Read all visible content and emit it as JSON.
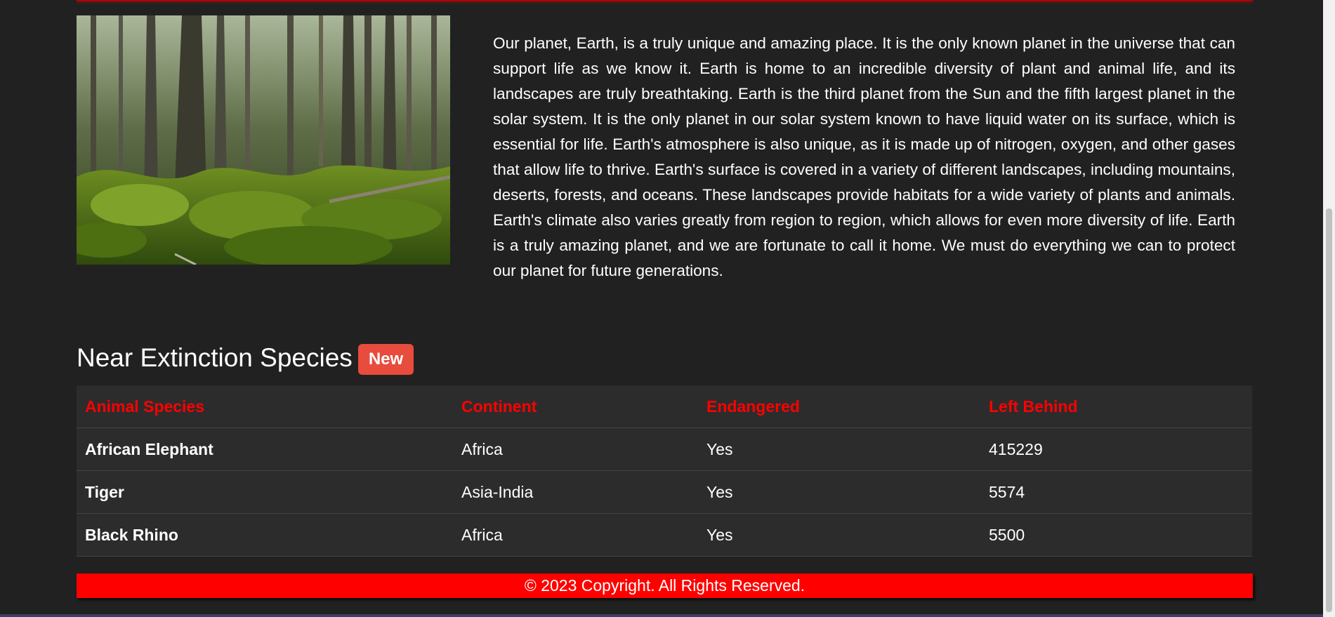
{
  "intro": {
    "image_alt": "Forest with tall trees and mossy ground",
    "description": "Our planet, Earth, is a truly unique and amazing place. It is the only known planet in the universe that can support life as we know it. Earth is home to an incredible diversity of plant and animal life, and its landscapes are truly breathtaking. Earth is the third planet from the Sun and the fifth largest planet in the solar system. It is the only planet in our solar system known to have liquid water on its surface, which is essential for life. Earth's atmosphere is also unique, as it is made up of nitrogen, oxygen, and other gases that allow life to thrive. Earth's surface is covered in a variety of different landscapes, including mountains, deserts, forests, and oceans. These landscapes provide habitats for a wide variety of plants and animals. Earth's climate also varies greatly from region to region, which allows for even more diversity of life. Earth is a truly amazing planet, and we are fortunate to call it home. We must do everything we can to protect our planet for future generations."
  },
  "species_section": {
    "title": "Near Extinction Species",
    "badge": "New",
    "columns": [
      "Animal Species",
      "Continent",
      "Endangered",
      "Left Behind"
    ],
    "rows": [
      [
        "African Elephant",
        "Africa",
        "Yes",
        "415229"
      ],
      [
        "Tiger",
        "Asia-India",
        "Yes",
        "5574"
      ],
      [
        "Black Rhino",
        "Africa",
        "Yes",
        "5500"
      ]
    ]
  },
  "footer": {
    "text": "© 2023 Copyright. All Rights Reserved."
  },
  "colors": {
    "background": "#212121",
    "accent": "#ff0000",
    "badge": "#e74c3c",
    "table_background": "#2c2c2c"
  }
}
